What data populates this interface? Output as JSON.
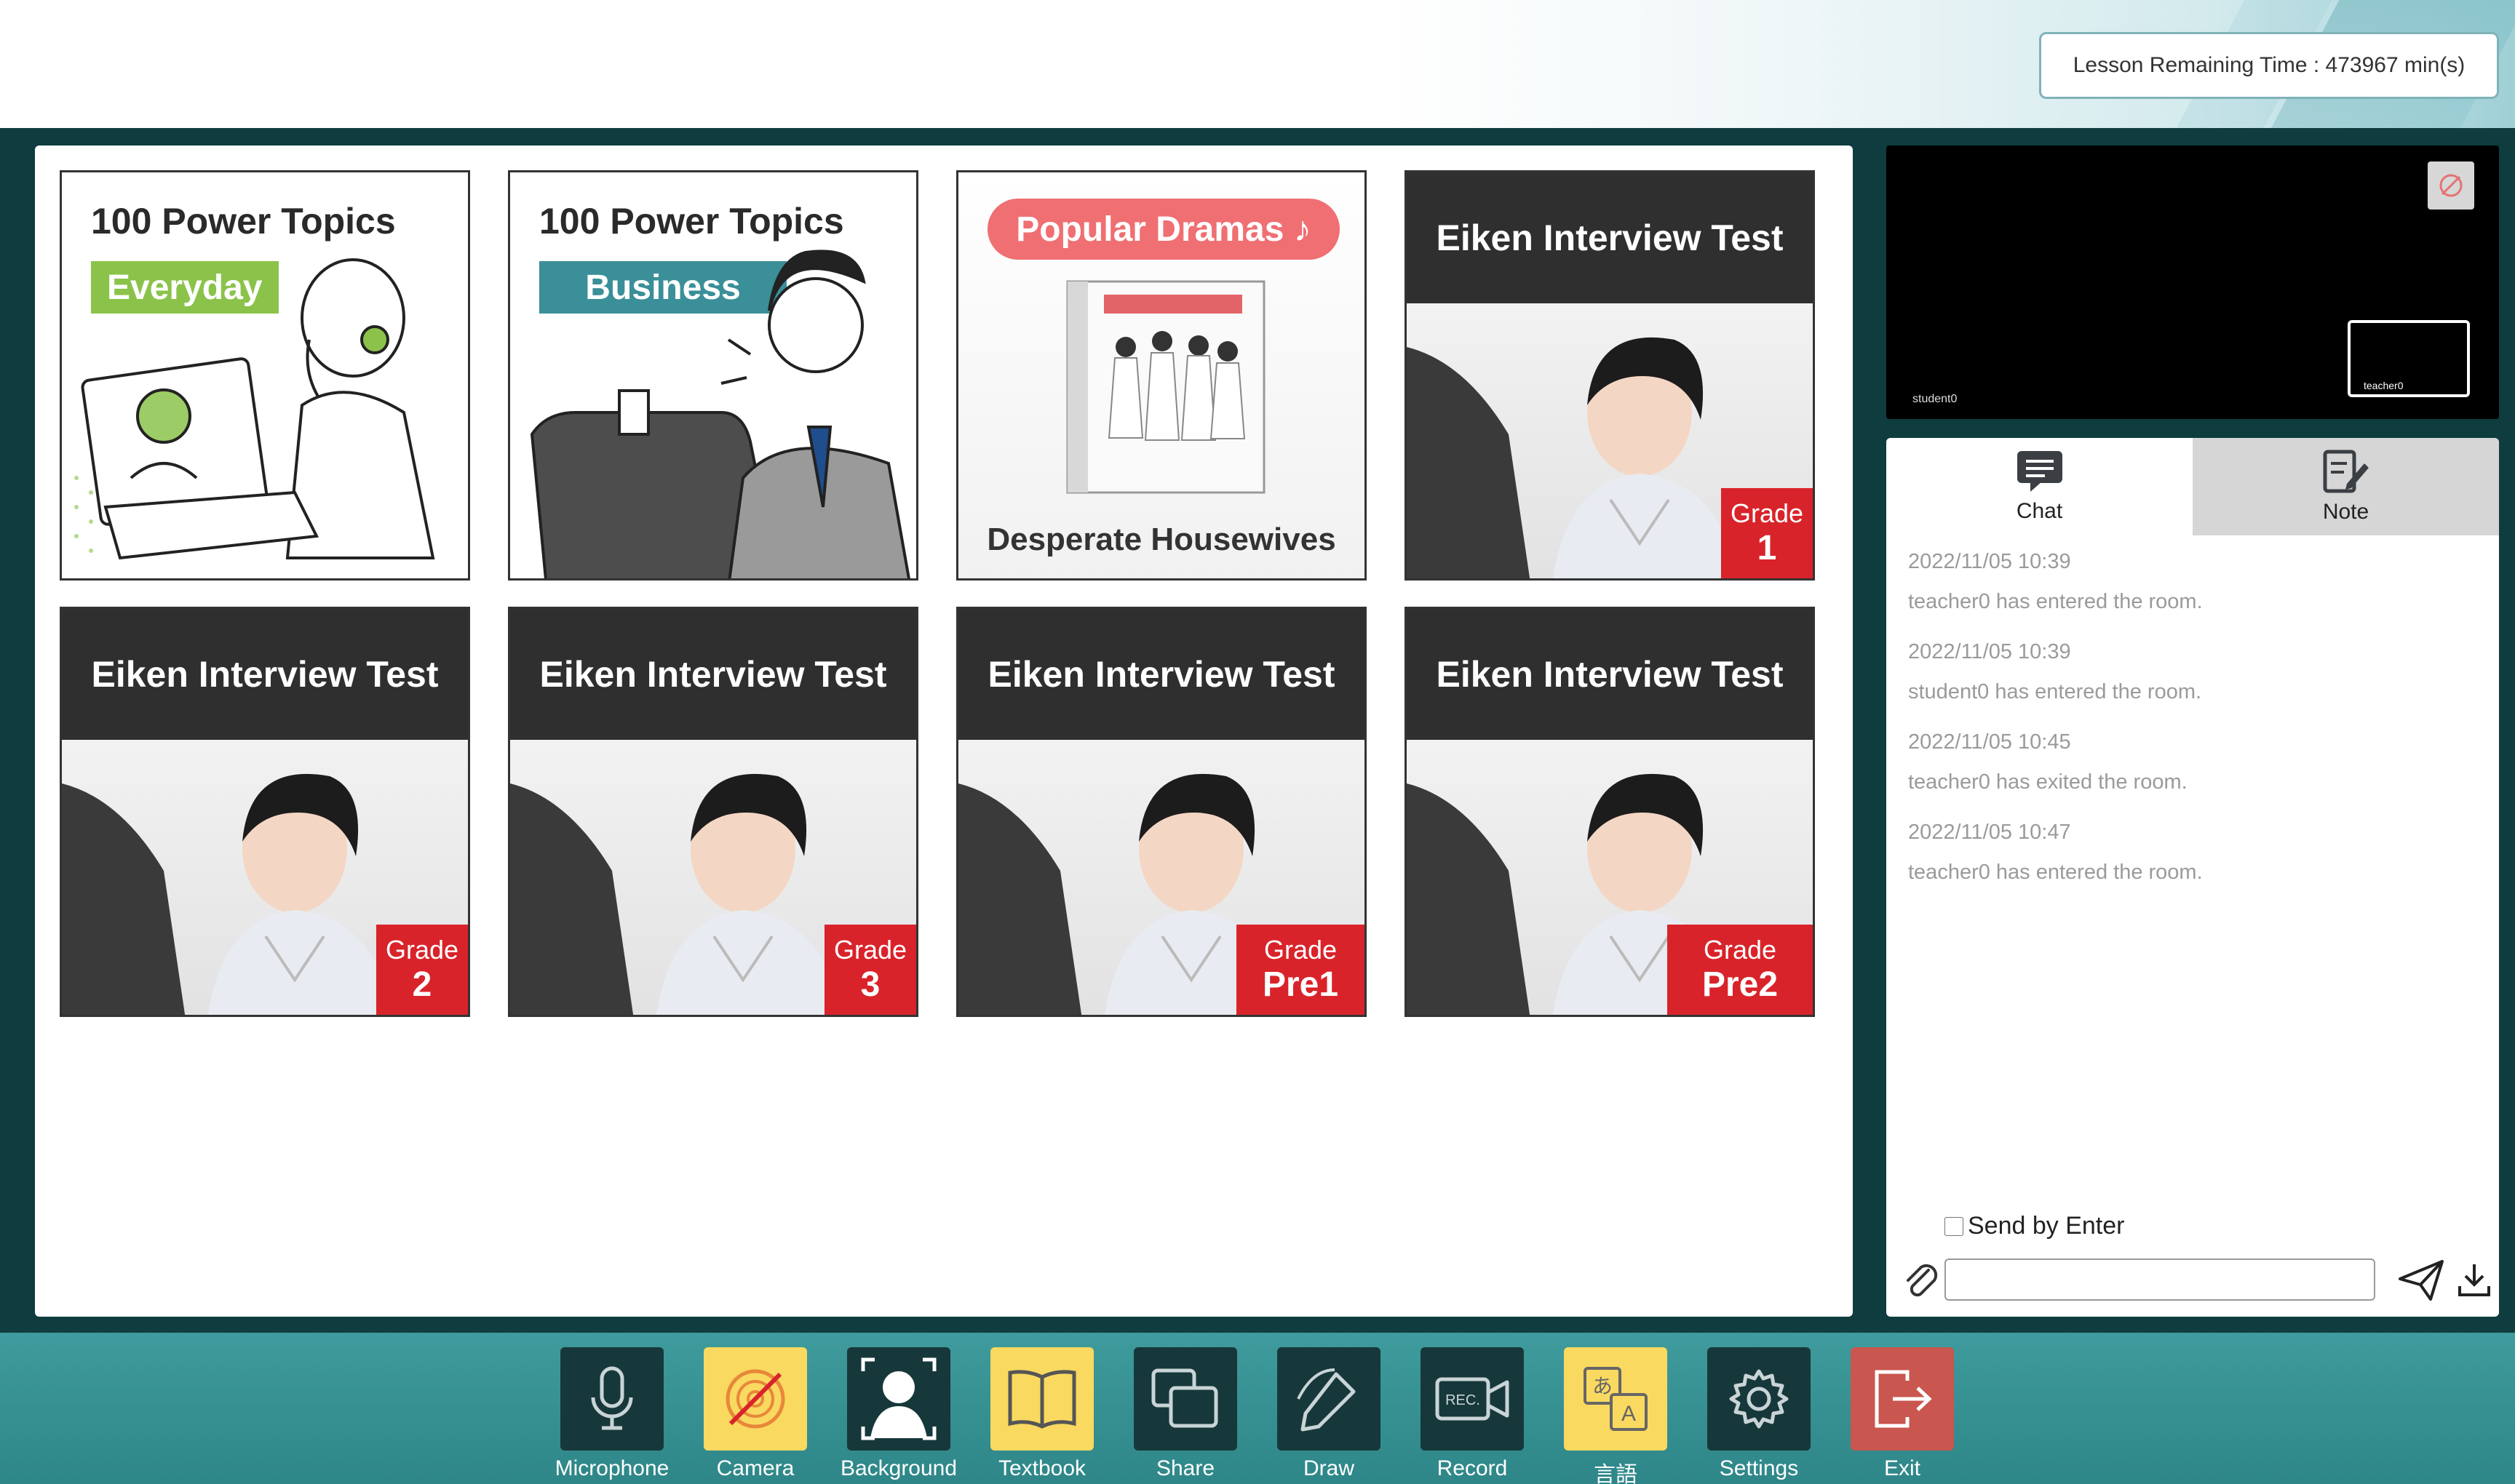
{
  "header": {
    "timer_text": "Lesson Remaining Time : 473967 min(s)"
  },
  "textbooks": {
    "card1": {
      "title": "100 Power Topics",
      "tag": "Everyday"
    },
    "card2": {
      "title": "100 Power Topics",
      "tag": "Business"
    },
    "card3": {
      "pill": "Popular Dramas ♪",
      "caption": "Desperate Housewives"
    },
    "eiken": [
      {
        "title": "Eiken Interview Test",
        "grade_label": "Grade",
        "grade": "1"
      },
      {
        "title": "Eiken Interview Test",
        "grade_label": "Grade",
        "grade": "2"
      },
      {
        "title": "Eiken Interview Test",
        "grade_label": "Grade",
        "grade": "3"
      },
      {
        "title": "Eiken Interview Test",
        "grade_label": "Grade",
        "grade": "Pre1"
      },
      {
        "title": "Eiken Interview Test",
        "grade_label": "Grade",
        "grade": "Pre2"
      }
    ]
  },
  "video": {
    "student_label": "student0",
    "teacher_label": "teacher0"
  },
  "chat": {
    "tab_chat": "Chat",
    "tab_note": "Note",
    "messages": [
      {
        "time": "2022/11/05 10:39",
        "text": "teacher0 has entered the room."
      },
      {
        "time": "2022/11/05 10:39",
        "text": "student0 has entered the room."
      },
      {
        "time": "2022/11/05 10:45",
        "text": "teacher0 has exited the room."
      },
      {
        "time": "2022/11/05 10:47",
        "text": "teacher0 has entered the room."
      }
    ],
    "send_by_enter": "Send by Enter",
    "input_value": ""
  },
  "toolbar": {
    "microphone": "Microphone",
    "camera": "Camera",
    "background": "Background",
    "textbook": "Textbook",
    "share": "Share",
    "draw": "Draw",
    "record": "Record",
    "language": "言語",
    "settings": "Settings",
    "exit": "Exit"
  },
  "icons": {
    "microphone": "microphone-icon",
    "camera": "camera-off-icon",
    "background": "background-person-icon",
    "textbook": "book-icon",
    "share": "screen-share-icon",
    "draw": "pen-icon",
    "record": "record-camera-icon",
    "language": "translate-icon",
    "settings": "gear-icon",
    "exit": "exit-door-icon"
  },
  "colors": {
    "toolbar_bg": "#3f9b9d",
    "button_dark": "#17383a",
    "button_yellow": "#f9d960",
    "button_red": "#c9564f",
    "grade_red": "#d9232a",
    "tag_green": "#8bc34a",
    "tag_teal": "#3a8f98"
  }
}
